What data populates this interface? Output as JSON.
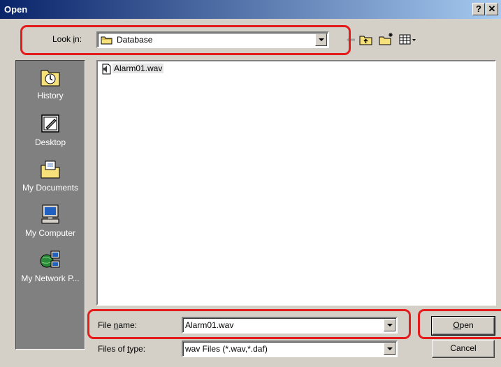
{
  "window": {
    "title": "Open",
    "help_glyph": "?",
    "close_glyph": "✕"
  },
  "look_in": {
    "label_pre": "Look ",
    "label_key": "i",
    "label_post": "n:",
    "value": "Database"
  },
  "toolbar": {
    "icons": [
      "back-arrow-icon",
      "up-folder-icon",
      "new-folder-icon",
      "view-menu-icon"
    ]
  },
  "sidebar": {
    "items": [
      {
        "label": "History",
        "icon": "history-icon"
      },
      {
        "label": "Desktop",
        "icon": "desktop-icon"
      },
      {
        "label": "My Documents",
        "icon": "my-documents-icon"
      },
      {
        "label": "My Computer",
        "icon": "my-computer-icon"
      },
      {
        "label": "My Network P...",
        "icon": "my-network-places-icon"
      }
    ]
  },
  "files": [
    {
      "name": "Alarm01.wav",
      "icon": "wav-file-icon"
    }
  ],
  "file_name": {
    "label_pre": "File ",
    "label_key": "n",
    "label_post": "ame:",
    "value": "Alarm01.wav"
  },
  "file_type": {
    "label_pre": "Files of ",
    "label_key": "t",
    "label_post": "ype:",
    "value": "wav Files (*.wav,*.daf)"
  },
  "buttons": {
    "open_key": "O",
    "open_rest": "pen",
    "cancel": "Cancel"
  },
  "colors": {
    "highlight": "#e41b1b",
    "titlebar_start": "#0a246a",
    "titlebar_end": "#a6caf0",
    "face": "#d4d0c8",
    "sidebar": "#808080"
  }
}
